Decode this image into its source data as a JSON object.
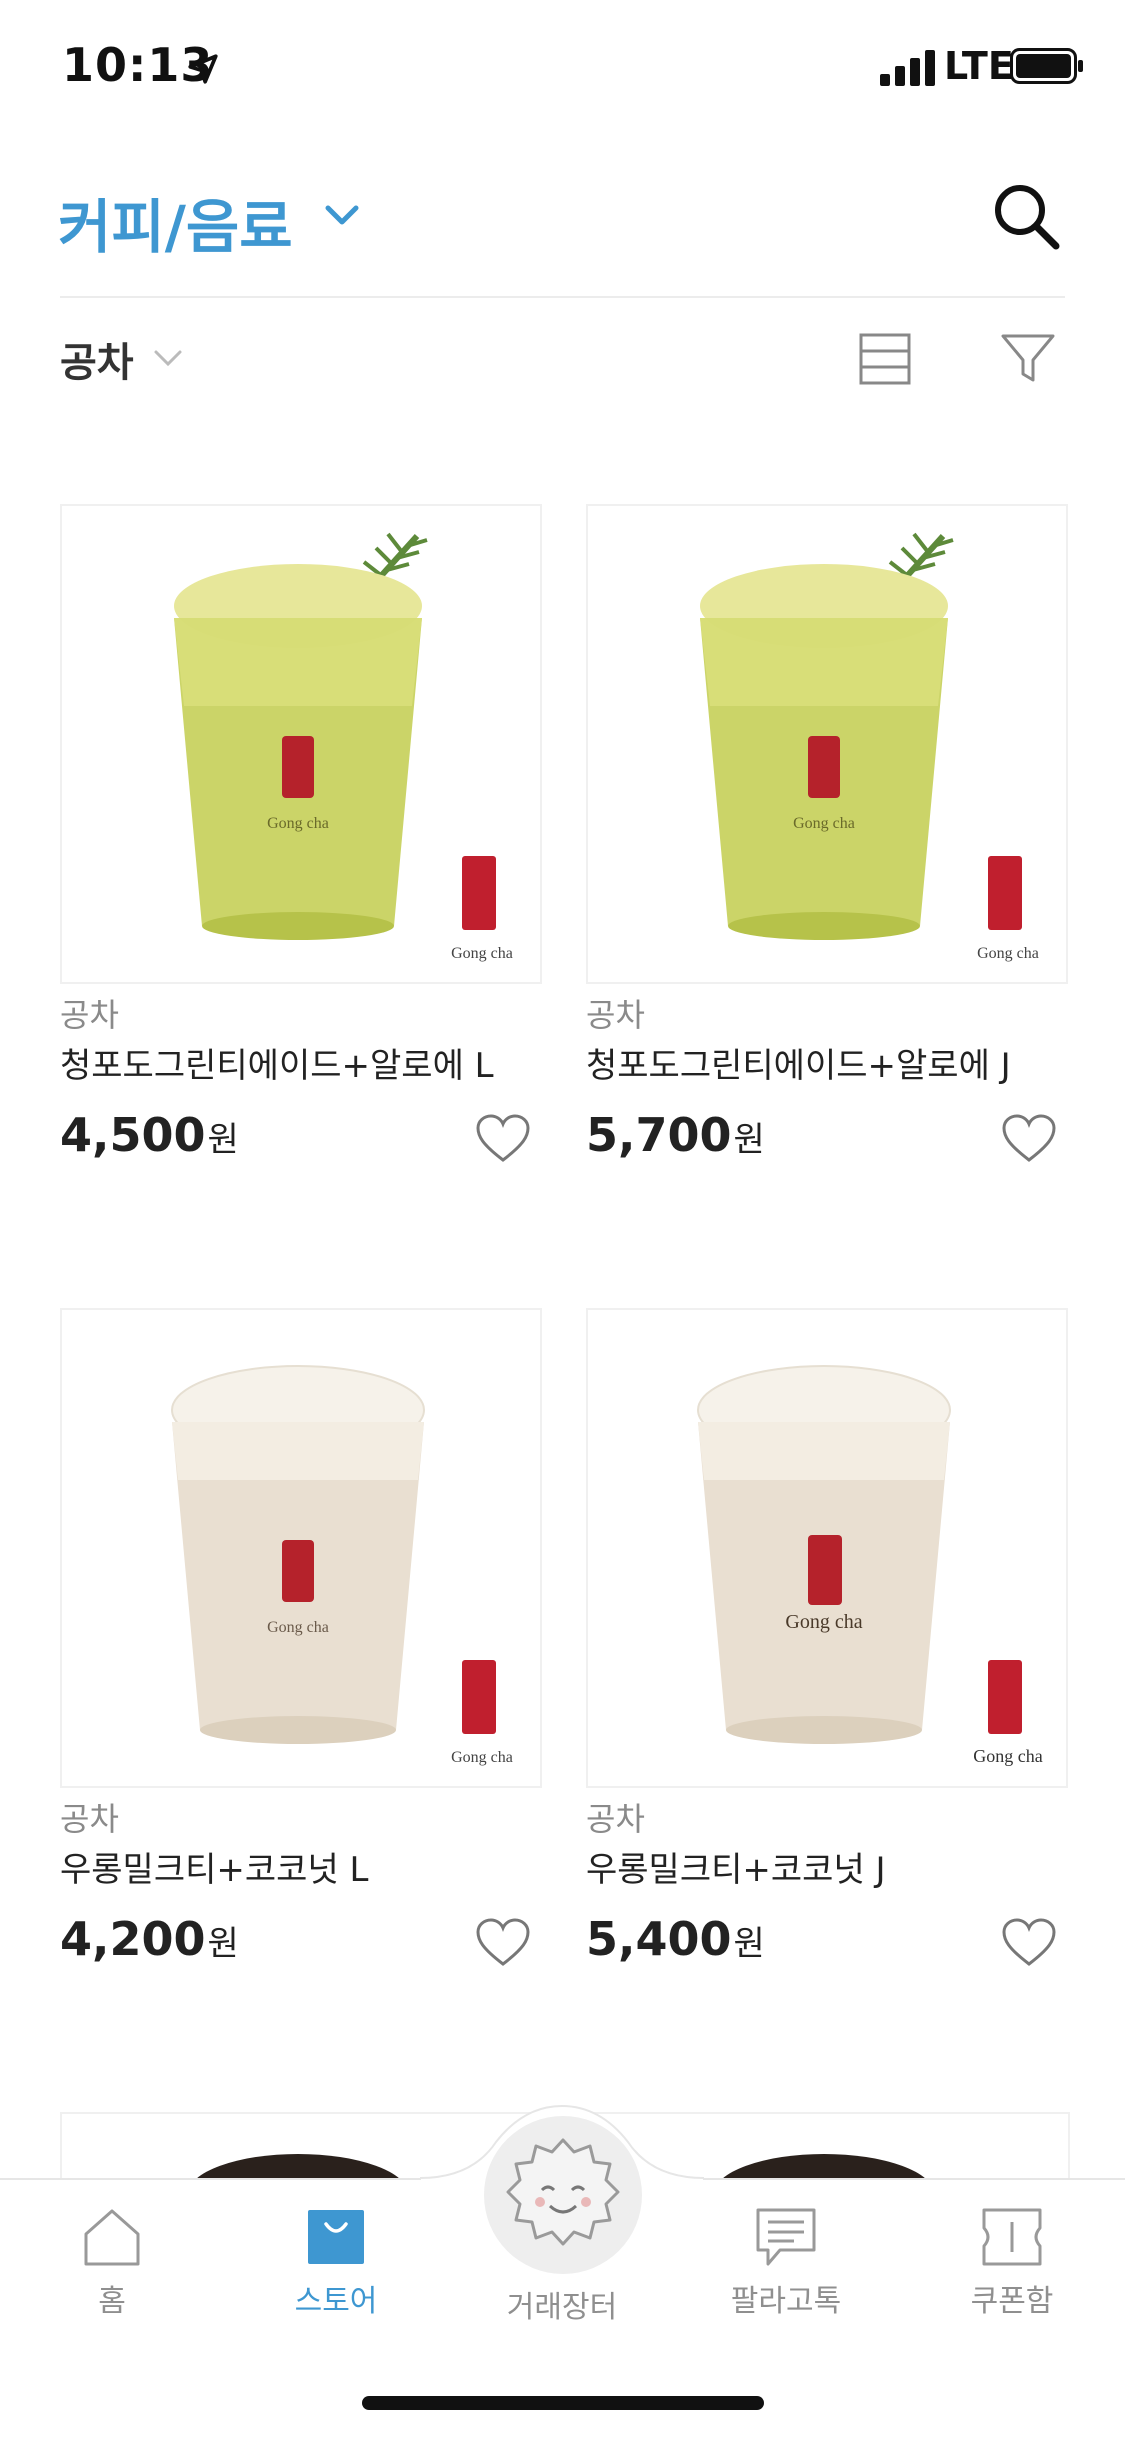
{
  "status_bar": {
    "time": "10:13",
    "network": "LTE"
  },
  "header": {
    "category_title": "커피/음료"
  },
  "filter": {
    "brand": "공차"
  },
  "products": [
    {
      "brand": "공차",
      "name": "청포도그린티에이드+알로에 L",
      "price": "4,500",
      "currency": "원",
      "drink_color": "#c5cf58",
      "logo_text": "Gong cha"
    },
    {
      "brand": "공차",
      "name": "청포도그린티에이드+알로에 J",
      "price": "5,700",
      "currency": "원",
      "drink_color": "#c5cf58",
      "logo_text": "Gong cha"
    },
    {
      "brand": "공차",
      "name": "우롱밀크티+코코넛 L",
      "price": "4,200",
      "currency": "원",
      "drink_color": "#e9dfd1",
      "logo_text": "Gong cha"
    },
    {
      "brand": "공차",
      "name": "우롱밀크티+코코넛 J",
      "price": "5,400",
      "currency": "원",
      "drink_color": "#e9dfd1",
      "logo_text": "Gong cha"
    }
  ],
  "tabs": [
    {
      "label": "홈",
      "icon": "home-icon"
    },
    {
      "label": "스토어",
      "icon": "store-bag-icon"
    },
    {
      "label": "거래장터",
      "icon": "mascot-icon"
    },
    {
      "label": "팔라고톡",
      "icon": "chat-icon"
    },
    {
      "label": "쿠폰함",
      "icon": "coupon-icon"
    }
  ],
  "colors": {
    "accent": "#3e97d1",
    "text": "#222222",
    "muted": "#8a8a8a"
  }
}
